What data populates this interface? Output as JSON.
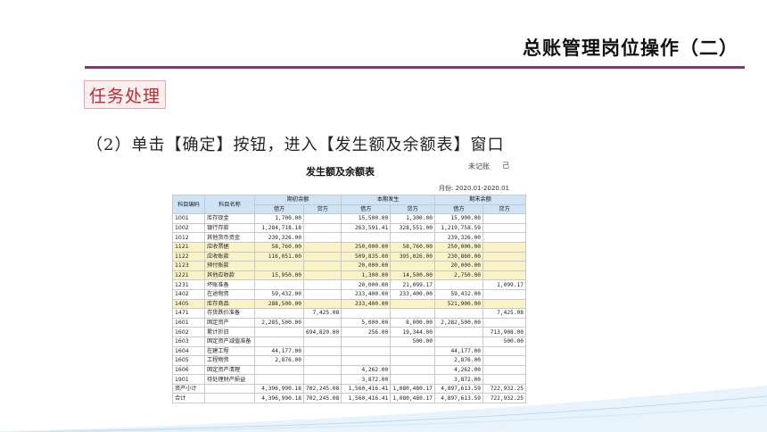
{
  "header": {
    "title": "总账管理岗位操作（二）"
  },
  "task": {
    "label": "任务处理"
  },
  "step": {
    "text": "（2）单击【确定】按钮，进入【发生额及余额表】窗口"
  },
  "report": {
    "title": "发生额及余额表",
    "period": "月份: 2020.01-2020.01",
    "crop_text": "未记账",
    "crop_text2": "己",
    "col_code": "科目编码",
    "col_name": "科目名称",
    "group_open": "期初余额",
    "group_occur": "本期发生",
    "group_close": "期末余额",
    "debit": "借方",
    "credit": "贷方",
    "rows": [
      {
        "code": "1001",
        "name": "库存现金",
        "ob_d": "1,700.00",
        "ob_c": "",
        "oc_d": "15,500.00",
        "oc_c": "1,300.00",
        "cb_d": "15,900.00",
        "cb_c": "",
        "hl": false
      },
      {
        "code": "1002",
        "name": "银行存款",
        "ob_d": "1,284,718.18",
        "ob_c": "",
        "oc_d": "263,591.41",
        "oc_c": "328,551.00",
        "cb_d": "1,219,758.59",
        "cb_c": "",
        "hl": false
      },
      {
        "code": "1012",
        "name": "其他货币资金",
        "ob_d": "239,326.00",
        "ob_c": "",
        "oc_d": "",
        "oc_c": "",
        "cb_d": "239,326.00",
        "cb_c": "",
        "hl": false
      },
      {
        "code": "1121",
        "name": "应收票据",
        "ob_d": "58,760.00",
        "ob_c": "",
        "oc_d": "250,000.00",
        "oc_c": "58,760.00",
        "cb_d": "250,000.00",
        "cb_c": "",
        "hl": true
      },
      {
        "code": "1122",
        "name": "应收账款",
        "ob_d": "116,051.00",
        "ob_c": "",
        "oc_d": "509,835.00",
        "oc_c": "395,026.00",
        "cb_d": "230,860.00",
        "cb_c": "",
        "hl": true
      },
      {
        "code": "1123",
        "name": "预付账款",
        "ob_d": "",
        "ob_c": "",
        "oc_d": "20,000.00",
        "oc_c": "",
        "cb_d": "20,000.00",
        "cb_c": "",
        "hl": true
      },
      {
        "code": "1221",
        "name": "其他应收款",
        "ob_d": "15,950.00",
        "ob_c": "",
        "oc_d": "1,300.00",
        "oc_c": "14,500.00",
        "cb_d": "2,750.00",
        "cb_c": "",
        "hl": true
      },
      {
        "code": "1231",
        "name": "坏账准备",
        "ob_d": "",
        "ob_c": "",
        "oc_d": "20,000.00",
        "oc_c": "21,099.17",
        "cb_d": "",
        "cb_c": "1,099.17",
        "hl": false
      },
      {
        "code": "1402",
        "name": "在途物资",
        "ob_d": "59,432.00",
        "ob_c": "",
        "oc_d": "233,400.00",
        "oc_c": "233,400.00",
        "cb_d": "59,432.00",
        "cb_c": "",
        "hl": false
      },
      {
        "code": "1405",
        "name": "库存商品",
        "ob_d": "288,500.00",
        "ob_c": "",
        "oc_d": "233,400.00",
        "oc_c": "",
        "cb_d": "521,900.00",
        "cb_c": "",
        "hl": true
      },
      {
        "code": "1471",
        "name": "存货跌价准备",
        "ob_d": "",
        "ob_c": "7,425.08",
        "oc_d": "",
        "oc_c": "",
        "cb_d": "",
        "cb_c": "7,425.08",
        "hl": false
      },
      {
        "code": "1601",
        "name": "固定资产",
        "ob_d": "2,285,500.00",
        "ob_c": "",
        "oc_d": "5,000.00",
        "oc_c": "8,000.00",
        "cb_d": "2,282,500.00",
        "cb_c": "",
        "hl": false
      },
      {
        "code": "1602",
        "name": "累计折旧",
        "ob_d": "",
        "ob_c": "694,820.00",
        "oc_d": "256.00",
        "oc_c": "19,344.00",
        "cb_d": "",
        "cb_c": "713,908.00",
        "hl": false
      },
      {
        "code": "1603",
        "name": "固定资产减值准备",
        "ob_d": "",
        "ob_c": "",
        "oc_d": "",
        "oc_c": "500.00",
        "cb_d": "",
        "cb_c": "500.00",
        "hl": false
      },
      {
        "code": "1604",
        "name": "在建工程",
        "ob_d": "44,177.00",
        "ob_c": "",
        "oc_d": "",
        "oc_c": "",
        "cb_d": "44,177.00",
        "cb_c": "",
        "hl": false
      },
      {
        "code": "1605",
        "name": "工程物资",
        "ob_d": "2,876.00",
        "ob_c": "",
        "oc_d": "",
        "oc_c": "",
        "cb_d": "2,876.00",
        "cb_c": "",
        "hl": false
      },
      {
        "code": "1606",
        "name": "固定资产清理",
        "ob_d": "",
        "ob_c": "",
        "oc_d": "4,262.00",
        "oc_c": "",
        "cb_d": "4,262.00",
        "cb_c": "",
        "hl": false
      },
      {
        "code": "1901",
        "name": "待处理财产损益",
        "ob_d": "",
        "ob_c": "",
        "oc_d": "3,872.00",
        "oc_c": "",
        "cb_d": "3,872.00",
        "cb_c": "",
        "hl": false
      },
      {
        "code": "资产小计",
        "name": "",
        "ob_d": "4,396,990.18",
        "ob_c": "702,245.08",
        "oc_d": "1,560,416.41",
        "oc_c": "1,080,480.17",
        "cb_d": "4,897,613.59",
        "cb_c": "722,932.25",
        "hl": false
      },
      {
        "code": "合计",
        "name": "",
        "ob_d": "4,396,990.18",
        "ob_c": "702,245.08",
        "oc_d": "1,560,416.41",
        "oc_c": "1,080,480.17",
        "cb_d": "4,897,613.59",
        "cb_c": "722,932.25",
        "hl": false
      }
    ]
  },
  "colors": {
    "rule": "#7b3b6e",
    "task_text": "#c0282f",
    "header_bg": "#cfe3f6",
    "highlight_row": "#fbf3c8"
  }
}
